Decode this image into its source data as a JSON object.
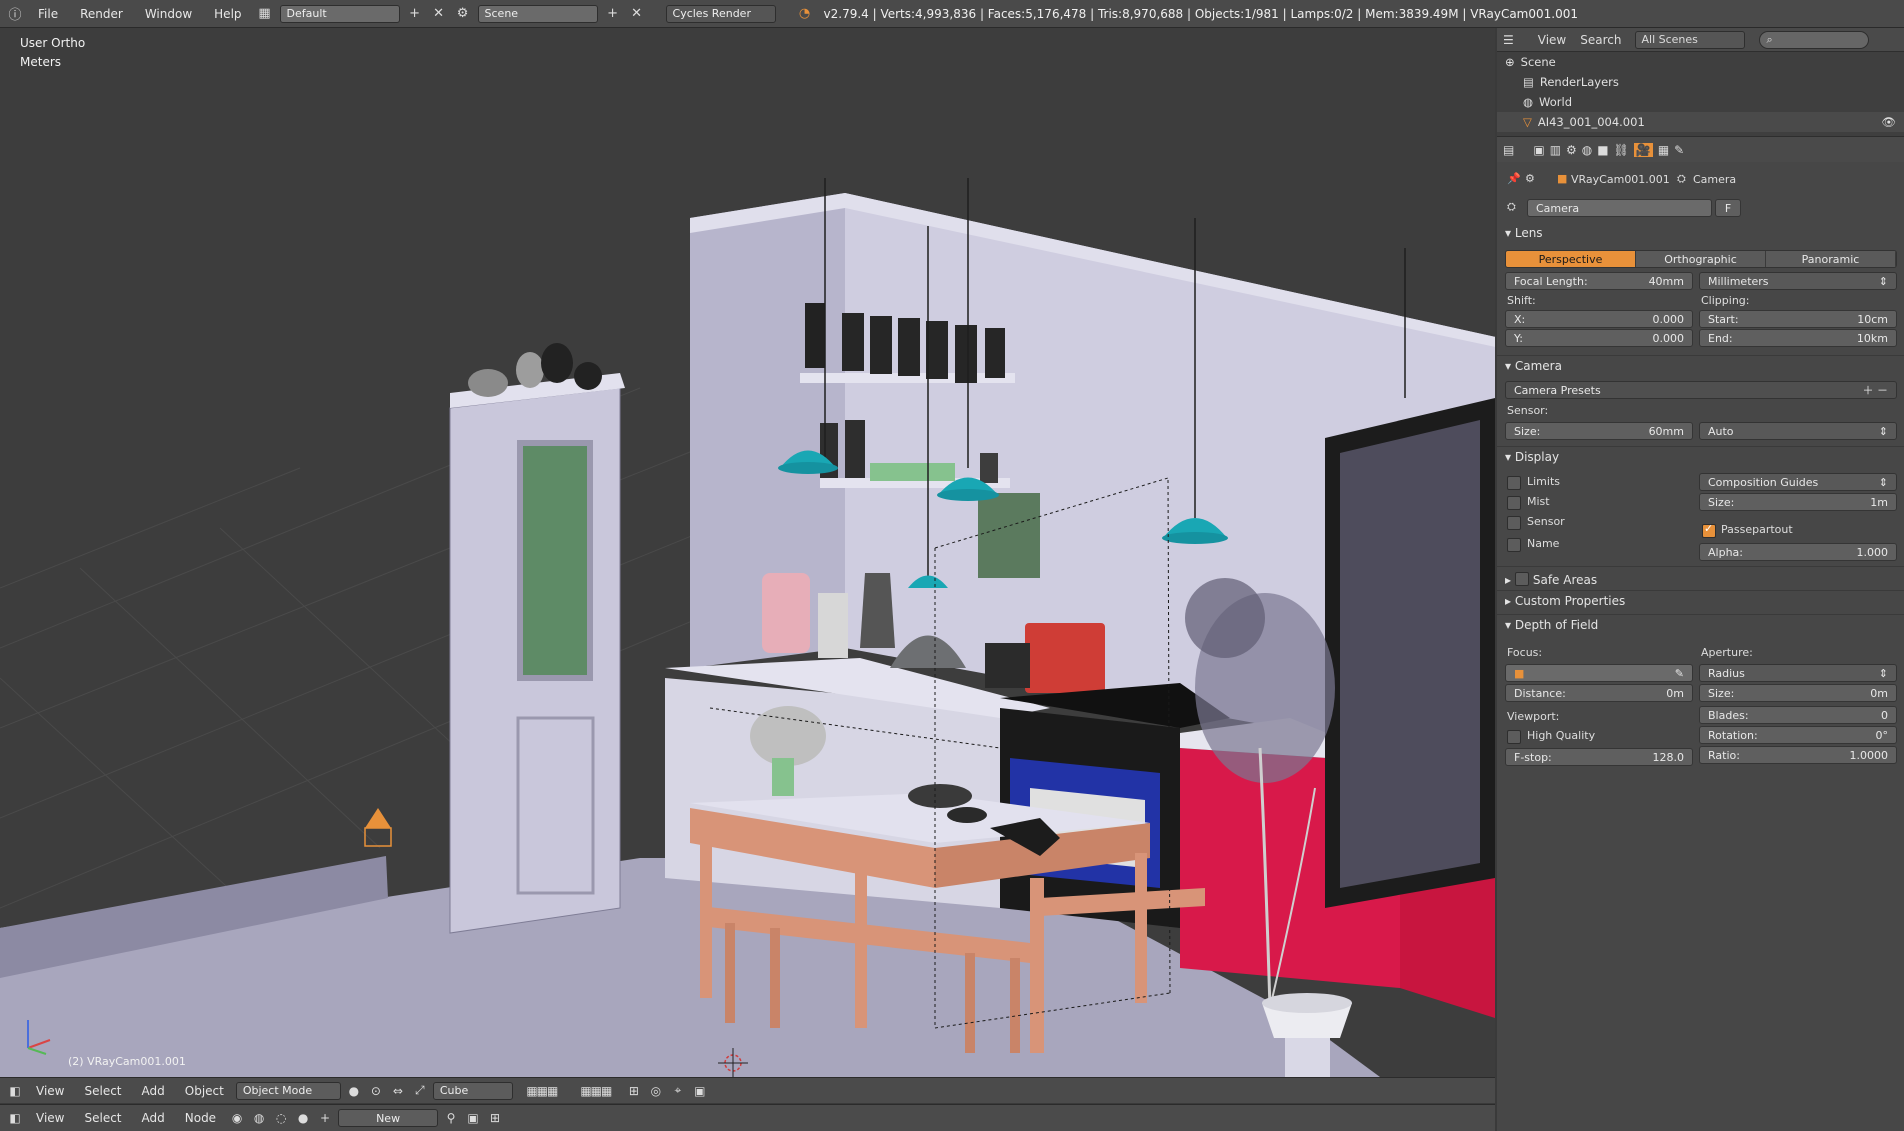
{
  "topbar": {
    "menu": [
      "File",
      "Render",
      "Window",
      "Help"
    ],
    "layout": "Default",
    "scene": "Scene",
    "engine": "Cycles Render",
    "stats": "v2.79.4 | Verts:4,993,836 | Faces:5,176,478 | Tris:8,970,688 | Objects:1/981 | Lamps:0/2 | Mem:3839.49M | VRayCam001.001"
  },
  "viewport": {
    "view_name": "User Ortho",
    "units": "Meters",
    "object_label": "(2) VRayCam001.001"
  },
  "view3d_header": {
    "menu": [
      "View",
      "Select",
      "Add",
      "Object"
    ],
    "mode": "Object Mode",
    "pivot": "Cube"
  },
  "node_header": {
    "menu": [
      "View",
      "Select",
      "Add",
      "Node"
    ],
    "new_label": "New"
  },
  "outliner": {
    "menu": [
      "View",
      "Search"
    ],
    "scope": "All Scenes",
    "items": [
      "Scene",
      "RenderLayers",
      "World",
      "AI43_001_004.001"
    ]
  },
  "properties": {
    "object": "VRayCam001.001",
    "data": "Camera",
    "datablock": "Camera",
    "datablock_flag": "F",
    "lens": {
      "title": "Lens",
      "types": [
        "Perspective",
        "Orthographic",
        "Panoramic"
      ],
      "focal_label": "Focal Length:",
      "focal_value": "40mm",
      "lens_unit": "Millimeters",
      "shift_label": "Shift:",
      "clipping_label": "Clipping:",
      "x_label": "X:",
      "x_value": "0.000",
      "y_label": "Y:",
      "y_value": "0.000",
      "start_label": "Start:",
      "start_value": "10cm",
      "end_label": "End:",
      "end_value": "10km"
    },
    "camera": {
      "title": "Camera",
      "presets": "Camera Presets",
      "sensor_label": "Sensor:",
      "size_label": "Size:",
      "size_value": "60mm",
      "fit": "Auto"
    },
    "display": {
      "title": "Display",
      "limits": "Limits",
      "mist": "Mist",
      "sensor": "Sensor",
      "name": "Name",
      "guides": "Composition Guides",
      "size_label": "Size:",
      "size_value": "1m",
      "passepartout": "Passepartout",
      "alpha_label": "Alpha:",
      "alpha_value": "1.000"
    },
    "safe_areas": "Safe Areas",
    "custom_props": "Custom Properties",
    "dof": {
      "title": "Depth of Field",
      "focus_label": "Focus:",
      "aperture_label": "Aperture:",
      "aperture_type": "Radius",
      "distance_label": "Distance:",
      "distance_value": "0m",
      "size_label": "Size:",
      "size_value": "0m",
      "viewport_label": "Viewport:",
      "blades_label": "Blades:",
      "blades_value": "0",
      "high_quality": "High Quality",
      "rotation_label": "Rotation:",
      "rotation_value": "0°",
      "fstop_label": "F-stop:",
      "fstop_value": "128.0",
      "ratio_label": "Ratio:",
      "ratio_value": "1.0000"
    }
  },
  "colors": {
    "accent": "#e8913a",
    "lamp": "#19a7b4",
    "cabinet_red": "#d8194a",
    "wood": "#d89478",
    "room": "#b5b3c9"
  }
}
